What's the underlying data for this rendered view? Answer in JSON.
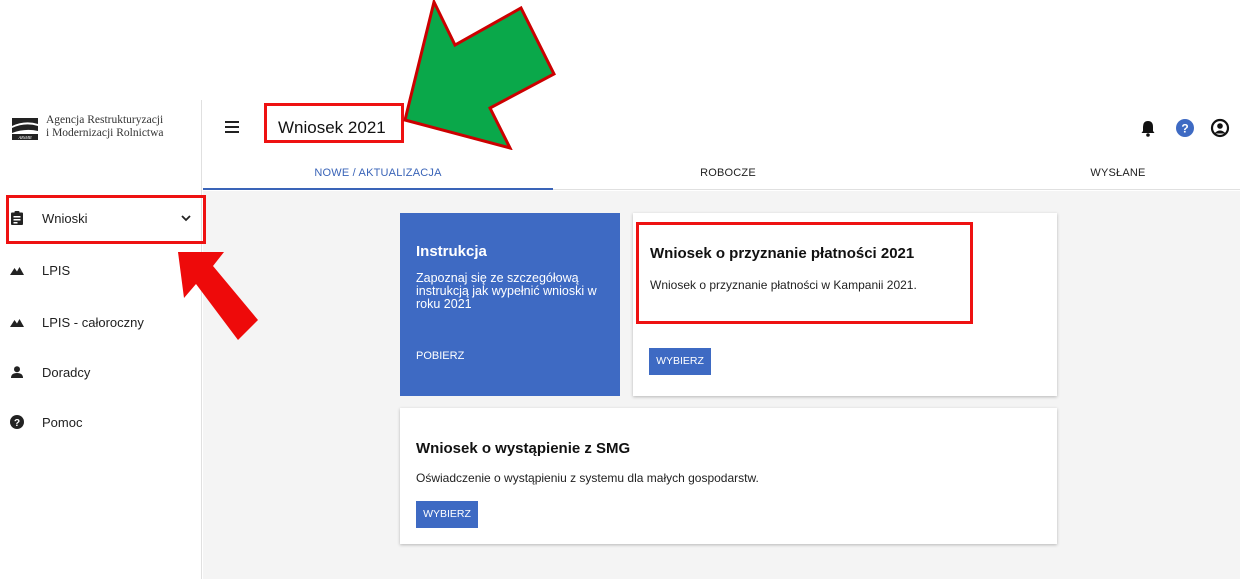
{
  "logo": {
    "line1": "Agencja Restrukturyzacji",
    "line2": "i Modernizacji Rolnictwa",
    "mark_text": "ARiMR"
  },
  "header": {
    "title": "Wniosek 2021",
    "icons": [
      "bell-icon",
      "help-icon",
      "account-icon"
    ]
  },
  "tabs": [
    {
      "label": "NOWE / AKTUALIZACJA",
      "active": true
    },
    {
      "label": "ROBOCZE",
      "active": false
    },
    {
      "label": "WYSŁANE",
      "active": false
    }
  ],
  "sidebar": {
    "items": [
      {
        "label": "Wnioski",
        "icon": "clipboard-icon",
        "expandable": true
      },
      {
        "label": "LPIS",
        "icon": "landscape-icon"
      },
      {
        "label": "LPIS - całoroczny",
        "icon": "landscape-icon"
      },
      {
        "label": "Doradcy",
        "icon": "person-icon"
      },
      {
        "label": "Pomoc",
        "icon": "help-icon"
      }
    ]
  },
  "cards": {
    "instruction": {
      "title": "Instrukcja",
      "text": "Zapoznaj się ze szczegółową instrukcją jak wypełnić wnioski w roku 2021",
      "link": "POBIERZ"
    },
    "payment": {
      "title": "Wniosek o przyznanie płatności 2021",
      "description": "Wniosek o przyznanie płatności w Kampanii 2021.",
      "button": "WYBIERZ"
    },
    "smg": {
      "title": "Wniosek o wystąpienie z SMG",
      "description": "Oświadczenie o wystąpieniu z systemu dla małych gospodarstw.",
      "button": "WYBIERZ"
    }
  },
  "colors": {
    "accent": "#3e6ac3",
    "annotation_red": "#ee1111",
    "annotation_green": "#0aa84a"
  }
}
